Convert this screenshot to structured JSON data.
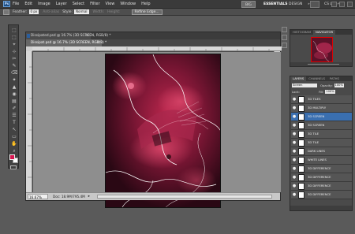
{
  "app": {
    "logo": "Ps"
  },
  "menu": [
    "File",
    "Edit",
    "Image",
    "Layer",
    "Select",
    "Filter",
    "View",
    "Window",
    "Help"
  ],
  "workspace": {
    "mode": "BIG",
    "essentials": "ESSENTIALS",
    "design": "DESIGN",
    "more": "»",
    "cslive": "CS Live ▾"
  },
  "options": {
    "feather_label": "Feather:",
    "feather_value": "0 px",
    "antialias_label": "Anti-alias",
    "style_label": "Style:",
    "style_value": "Normal",
    "width_label": "Width:",
    "height_label": "Height:",
    "refine_label": "Refine Edge..."
  },
  "tools": [
    "⬚",
    "⬚",
    "⌖",
    "⊹",
    "✂",
    "✎",
    "⌫",
    "✦",
    "▲",
    "◉",
    "▤",
    "✐",
    "☰",
    "T",
    "↖",
    "▭",
    "✋",
    "⌕"
  ],
  "document": {
    "tab1": "Dissipated.psd @ 16.7% (3D SCREEN, RGB/8) *",
    "tab2": "Dissipat.psd @ 16.7% (3D SCREEN, RGB/8) *",
    "zoom": "16.67%",
    "doc_size": "Doc: 18.9M/795.4M",
    "status_arrow": "▸"
  },
  "colors": {
    "foreground": "#d6164f",
    "background": "#ffffff"
  },
  "navigator": {
    "tabs": [
      "HISTOGRAM",
      "NAVIGATOR"
    ],
    "active_tab": 1
  },
  "layers_panel": {
    "tabs": [
      "LAYERS",
      "CHANNELS",
      "PATHS"
    ],
    "blend_mode": "Screen",
    "opacity_label": "Opacity:",
    "opacity_value": "100%",
    "lock_label": "Lock:",
    "fill_label": "Fill:",
    "fill_value": "100%",
    "layers": [
      {
        "name": "3D TILES",
        "selected": false
      },
      {
        "name": "3D MULTIPLY",
        "selected": false
      },
      {
        "name": "3D SCREEN",
        "selected": true
      },
      {
        "name": "3D SCREEN",
        "selected": false
      },
      {
        "name": "3D TILE",
        "selected": false
      },
      {
        "name": "3D TILE",
        "selected": false
      },
      {
        "name": "DARK LINES",
        "selected": false
      },
      {
        "name": "WHITE LINES",
        "selected": false
      },
      {
        "name": "3D DIFFERENCE",
        "selected": false
      },
      {
        "name": "3D DIFFERENCE",
        "selected": false
      },
      {
        "name": "3D DIFFERENCE",
        "selected": false
      },
      {
        "name": "3D DIFFERENCE",
        "selected": false
      }
    ]
  }
}
